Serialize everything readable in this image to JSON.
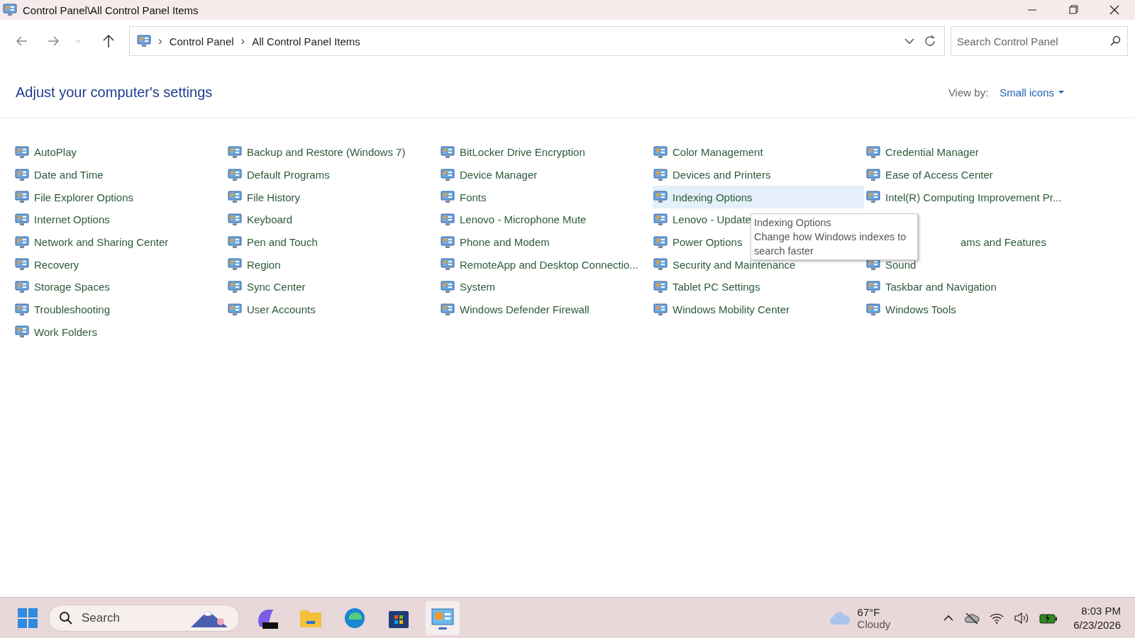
{
  "window": {
    "title": "Control Panel\\All Control Panel Items"
  },
  "address_bar": {
    "breadcrumbs": [
      "Control Panel",
      "All Control Panel Items"
    ],
    "separator": "›"
  },
  "search": {
    "placeholder": "Search Control Panel"
  },
  "header": {
    "title": "Adjust your computer's settings",
    "view_by_label": "View by:",
    "view_by_value": "Small icons"
  },
  "items": [
    {
      "kind": "applet",
      "label": "AutoPlay",
      "selected": false
    },
    {
      "kind": "applet",
      "label": "Backup and Restore (Windows 7)",
      "selected": false
    },
    {
      "kind": "applet",
      "label": "BitLocker Drive Encryption",
      "selected": false
    },
    {
      "kind": "applet",
      "label": "Color Management",
      "selected": false
    },
    {
      "kind": "applet",
      "label": "Credential Manager",
      "selected": false
    },
    {
      "kind": "applet",
      "label": "Date and Time",
      "selected": false
    },
    {
      "kind": "applet",
      "label": "Default Programs",
      "selected": false
    },
    {
      "kind": "applet",
      "label": "Device Manager",
      "selected": false
    },
    {
      "kind": "applet",
      "label": "Devices and Printers",
      "selected": false
    },
    {
      "kind": "applet",
      "label": "Ease of Access Center",
      "selected": false
    },
    {
      "kind": "applet",
      "label": "File Explorer Options",
      "selected": false
    },
    {
      "kind": "applet",
      "label": "File History",
      "selected": false
    },
    {
      "kind": "applet",
      "label": "Fonts",
      "selected": false
    },
    {
      "kind": "applet",
      "label": "Indexing Options",
      "selected": true
    },
    {
      "kind": "applet",
      "label": "Intel(R) Computing Improvement Pr...",
      "selected": false
    },
    {
      "kind": "applet",
      "label": "Internet Options",
      "selected": false
    },
    {
      "kind": "applet",
      "label": "Keyboard",
      "selected": false
    },
    {
      "kind": "applet",
      "label": "Lenovo - Microphone Mute",
      "selected": false
    },
    {
      "kind": "applet",
      "label": "Lenovo - Update",
      "selected": false
    },
    {
      "kind": "covered"
    },
    {
      "kind": "applet",
      "label": "Network and Sharing Center",
      "selected": false
    },
    {
      "kind": "applet",
      "label": "Pen and Touch",
      "selected": false
    },
    {
      "kind": "applet",
      "label": "Phone and Modem",
      "selected": false
    },
    {
      "kind": "applet",
      "label": "Power Options",
      "selected": false
    },
    {
      "kind": "partial",
      "label": "ams and Features",
      "selected": false
    },
    {
      "kind": "applet",
      "label": "Recovery",
      "selected": false
    },
    {
      "kind": "applet",
      "label": "Region",
      "selected": false
    },
    {
      "kind": "applet",
      "label": "RemoteApp and Desktop Connectio...",
      "selected": false
    },
    {
      "kind": "applet",
      "label": "Security and Maintenance",
      "selected": false
    },
    {
      "kind": "applet",
      "label": "Sound",
      "selected": false
    },
    {
      "kind": "applet",
      "label": "Storage Spaces",
      "selected": false
    },
    {
      "kind": "applet",
      "label": "Sync Center",
      "selected": false
    },
    {
      "kind": "applet",
      "label": "System",
      "selected": false
    },
    {
      "kind": "applet",
      "label": "Tablet PC Settings",
      "selected": false
    },
    {
      "kind": "applet",
      "label": "Taskbar and Navigation",
      "selected": false
    },
    {
      "kind": "applet",
      "label": "Troubleshooting",
      "selected": false
    },
    {
      "kind": "applet",
      "label": "User Accounts",
      "selected": false
    },
    {
      "kind": "applet",
      "label": "Windows Defender Firewall",
      "selected": false
    },
    {
      "kind": "applet",
      "label": "Windows Mobility Center",
      "selected": false
    },
    {
      "kind": "applet",
      "label": "Windows Tools",
      "selected": false
    },
    {
      "kind": "applet",
      "label": "Work Folders",
      "selected": false
    }
  ],
  "tooltip": {
    "title": "Indexing Options",
    "description": "Change how Windows indexes to search faster"
  },
  "taskbar": {
    "search_placeholder": "Search",
    "weather": {
      "temperature": "67°F",
      "condition": "Cloudy"
    },
    "time": "8:03 PM",
    "date": "6/23/2026"
  }
}
